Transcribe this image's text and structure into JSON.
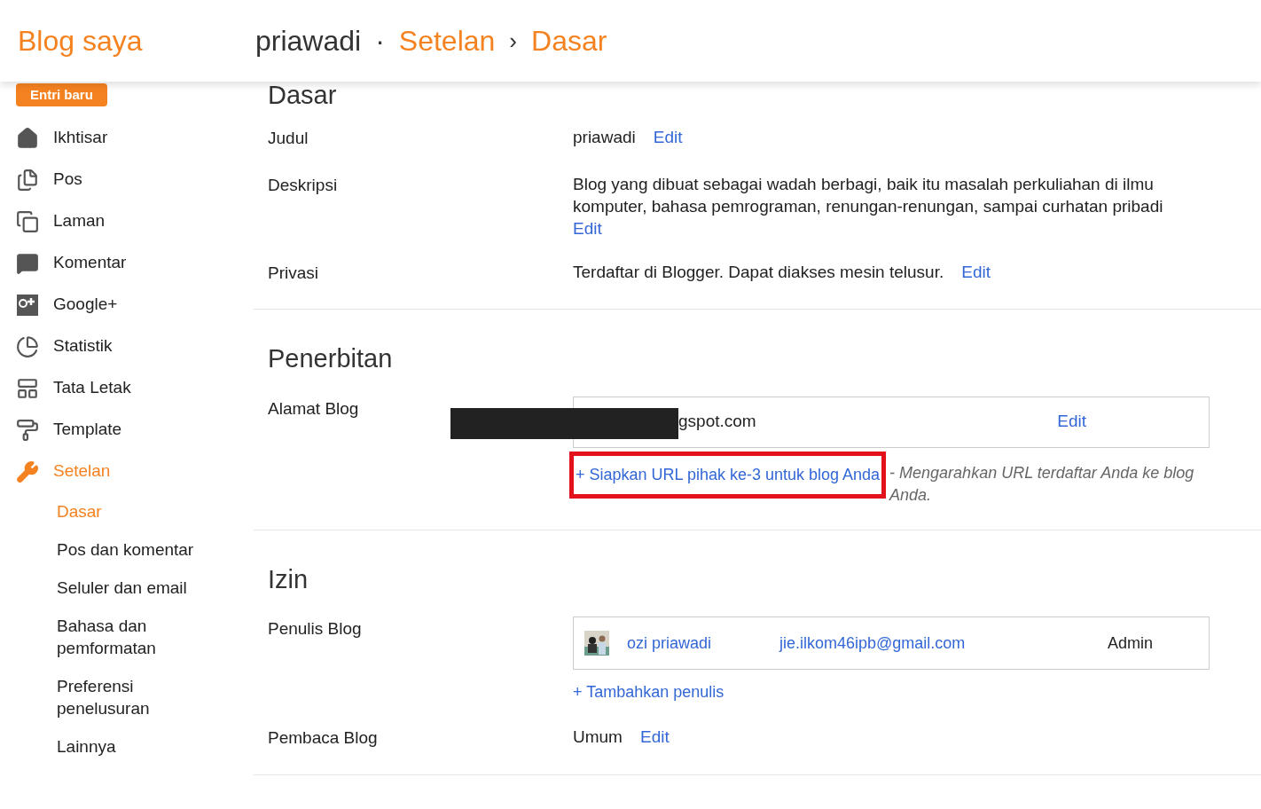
{
  "header": {
    "title": "Blog saya",
    "blog_name": "priawadi",
    "dot": "·",
    "section": "Setelan",
    "arrow": "›",
    "page": "Dasar"
  },
  "sidebar": {
    "new_post_button": "Entri baru",
    "items": [
      {
        "label": "Ikhtisar",
        "selected": false
      },
      {
        "label": "Pos",
        "selected": false
      },
      {
        "label": "Laman",
        "selected": false
      },
      {
        "label": "Komentar",
        "selected": false
      },
      {
        "label": "Google+",
        "selected": false
      },
      {
        "label": "Statistik",
        "selected": false
      },
      {
        "label": "Tata Letak",
        "selected": false
      },
      {
        "label": "Template",
        "selected": false
      },
      {
        "label": "Setelan",
        "selected": true,
        "children": [
          {
            "label": "Dasar",
            "selected": true
          },
          {
            "label": "Pos dan komentar",
            "selected": false
          },
          {
            "label": "Seluler dan email",
            "selected": false
          },
          {
            "label": "Bahasa dan pemformatan",
            "selected": false
          },
          {
            "label": "Preferensi penelusuran",
            "selected": false
          },
          {
            "label": "Lainnya",
            "selected": false
          }
        ]
      }
    ]
  },
  "sections": [
    {
      "title": "Dasar",
      "rows": [
        {
          "kind": "text",
          "label": "Judul",
          "value": "priawadi",
          "action": "Edit"
        },
        {
          "kind": "text",
          "label": "Deskripsi",
          "value": "Blog yang dibuat sebagai wadah berbagi, baik itu masalah perkuliahan di ilmu komputer, bahasa pemrograman, renungan-renungan, sampai curhatan pribadi",
          "action": "Edit"
        },
        {
          "kind": "text",
          "label": "Privasi",
          "value": "Terdaftar di Blogger. Dapat diakses mesin telusur.",
          "action": "Edit"
        }
      ]
    },
    {
      "title": "Penerbitan",
      "rows": [
        {
          "kind": "address",
          "label": "Alamat Blog",
          "value": "gspot.com",
          "action": "Edit",
          "link": "+ Siapkan URL pihak ke-3 untuk blog Anda",
          "hint": "- Mengarahkan URL terdaftar Anda ke blog Anda."
        }
      ]
    },
    {
      "title": "Izin",
      "rows": [
        {
          "kind": "authors",
          "label": "Penulis Blog",
          "authors": [
            {
              "name": "ozi priawadi",
              "email": "jie.ilkom46ipb@gmail.com",
              "role": "Admin"
            }
          ],
          "link": "+ Tambahkan penulis"
        },
        {
          "kind": "text",
          "label": "Pembaca Blog",
          "value": "Umum",
          "action": "Edit"
        }
      ]
    }
  ]
}
